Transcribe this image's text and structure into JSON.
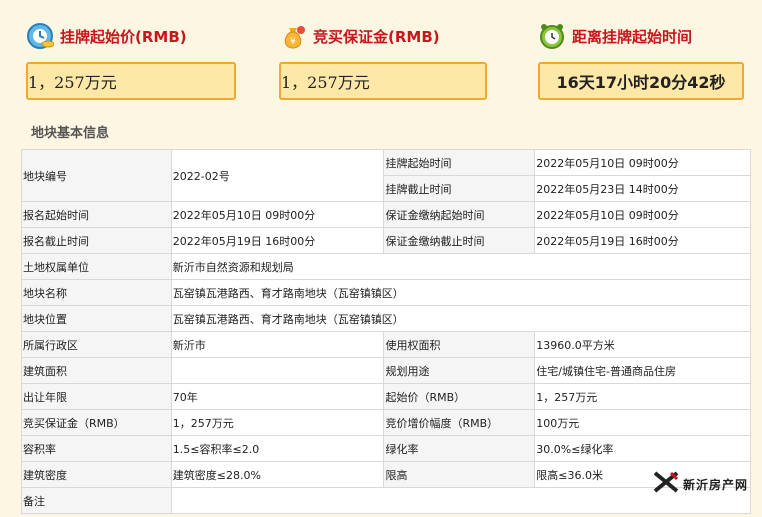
{
  "cards": {
    "start_price": {
      "title": "挂牌起始价(RMB)",
      "value": "1，257万元",
      "icon": "coins-icon"
    },
    "deposit": {
      "title": "竞买保证金(RMB)",
      "value": "1，257万元",
      "icon": "money-bag-icon"
    },
    "countdown": {
      "title": "距离挂牌起始时间",
      "value": "16天17小时20分42秒",
      "icon": "alarm-clock-icon"
    }
  },
  "section_title": "地块基本信息",
  "table": {
    "parcel_no_label": "地块编号",
    "parcel_no": "2022-02号",
    "listing_start_label": "挂牌起始时间",
    "listing_start": "2022年05月10日 09时00分",
    "listing_end_label": "挂牌截止时间",
    "listing_end": "2022年05月23日 14时00分",
    "reg_start_label": "报名起始时间",
    "reg_start": "2022年05月10日 09时00分",
    "deposit_start_label": "保证金缴纳起始时间",
    "deposit_start": "2022年05月10日 09时00分",
    "reg_end_label": "报名截止时间",
    "reg_end": "2022年05月19日 16时00分",
    "deposit_end_label": "保证金缴纳截止时间",
    "deposit_end": "2022年05月19日 16时00分",
    "owner_label": "土地权属单位",
    "owner": "新沂市自然资源和规划局",
    "name_label": "地块名称",
    "name": "瓦窑镇瓦港路西、育才路南地块（瓦窑镇镇区）",
    "location_label": "地块位置",
    "location": "瓦窑镇瓦港路西、育才路南地块（瓦窑镇镇区）",
    "district_label": "所属行政区",
    "district": "新沂市",
    "use_area_label": "使用权面积",
    "use_area": "13960.0平方米",
    "build_area_label": "建筑面积",
    "build_area": "",
    "plan_use_label": "规划用途",
    "plan_use": "住宅/城镇住宅-普通商品住房",
    "term_label": "出让年限",
    "term": "70年",
    "start_price_label": "起始价（RMB）",
    "start_price": "1，257万元",
    "deposit_label": "竞买保证金（RMB）",
    "deposit": "1，257万元",
    "increment_label": "竞价增价幅度（RMB）",
    "increment": "100万元",
    "far_label": "容积率",
    "far": "1.5≤容积率≤2.0",
    "green_label": "绿化率",
    "green": "30.0%≤绿化率",
    "density_label": "建筑密度",
    "density": "建筑密度≤28.0%",
    "height_label": "限高",
    "height": "限高≤36.0米",
    "remark_label": "备注",
    "remark": ""
  },
  "watermark": {
    "text": "新沂房产网",
    "icon": "x-logo-icon"
  }
}
